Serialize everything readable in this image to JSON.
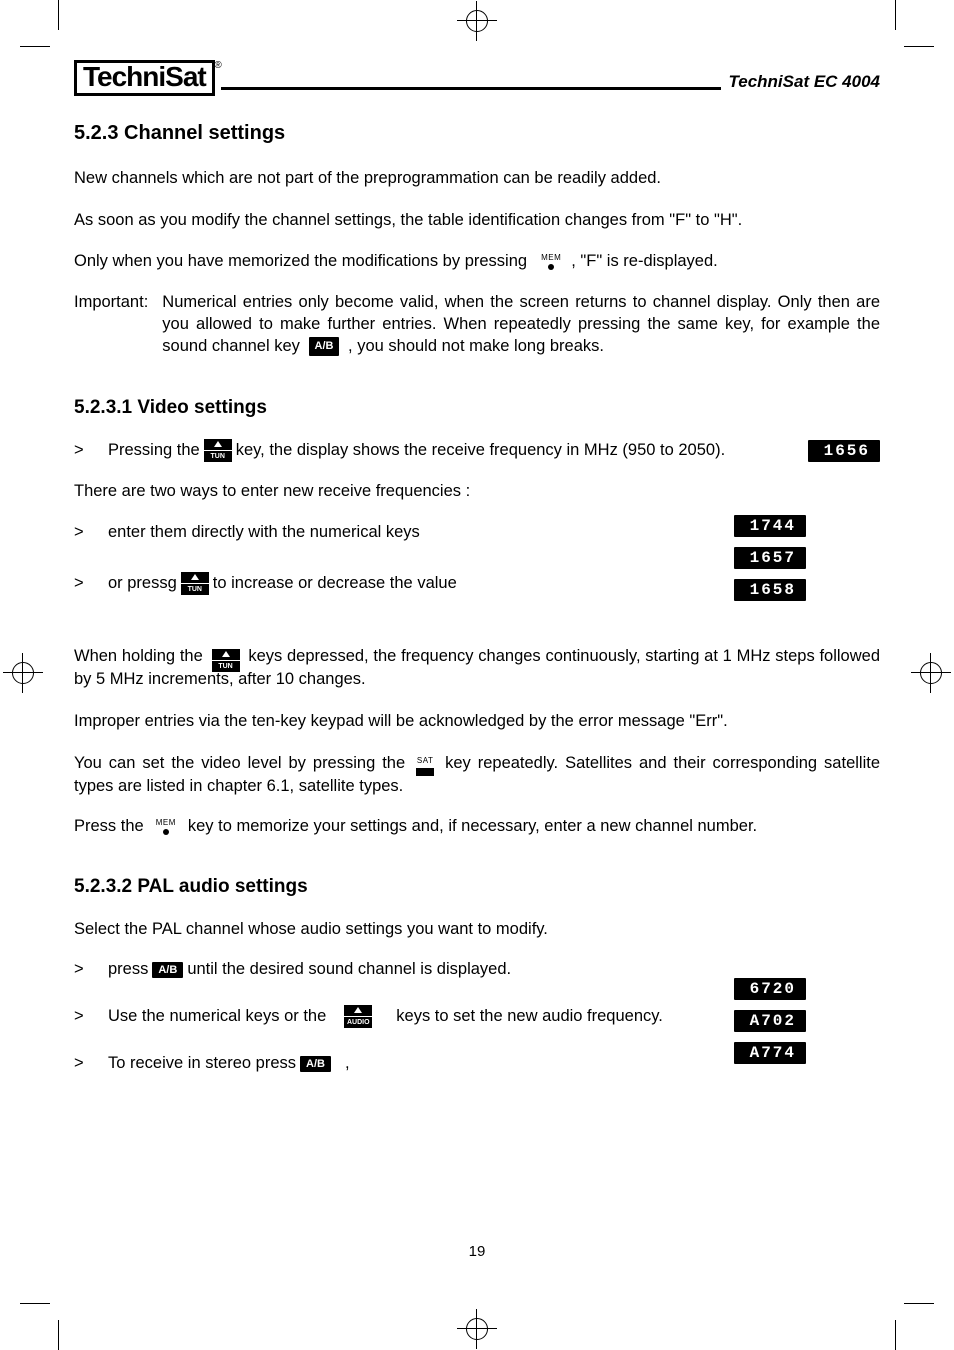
{
  "header": {
    "logo_text": "TechniSat",
    "logo_reg": "®",
    "model": "TechniSat EC 4004"
  },
  "section_523": {
    "number_title": "5.2.3 Channel settings",
    "p1": "New channels which are not part of the preprogrammation can be readily added.",
    "p2": "As soon as you modify the channel settings, the table identification changes from \"F\" to \"H\".",
    "p3_a": "Only when you have memorized the modifications by pressing",
    "p3_b": ", \"F\" is re-displayed.",
    "important_label": "Important:",
    "important_a": "Numerical entries only become valid, when the screen returns to channel display. Only then are you allowed to make further entries. When repeatedly pressing the same key, for example the sound channel key",
    "important_b": ", you should not make long breaks."
  },
  "section_5231": {
    "number_title": "5.2.3.1  Video settings",
    "b1_a": "Pressing the",
    "b1_b": "key, the display shows the receive frequency in MHz (950 to 2050).",
    "p_twoways": "There are two ways to enter new receive frequencies :",
    "b2": "enter them directly with the numerical keys",
    "b3_a": "or pressg",
    "b3_b": "to increase or decrease the value",
    "p_hold_a": "When holding the",
    "p_hold_b": "keys depressed, the frequency changes continuously, starting at 1 MHz steps followed by 5 MHz increments, after 10 changes.",
    "p_err": "Improper entries via the ten-key keypad will be acknowledged by the error message \"Err\".",
    "p_sat_a": "You can set the video level by pressing the",
    "p_sat_b": "key repeatedly. Satellites and their corresponding satellite types are listed in chapter 6.1, satellite types.",
    "p_mem_a": "Press the",
    "p_mem_b": "key to memorize your settings and, if necessary, enter a new channel number."
  },
  "section_5232": {
    "number_title": "5.2.3.2 PAL audio settings",
    "p1": "Select the PAL channel whose audio settings you want to modify.",
    "b1_a": "press",
    "b1_b": "until the desired sound channel is displayed.",
    "b2_a": "Use the numerical keys or the",
    "b2_b": "keys to set the new audio frequency.",
    "b3_a": "To receive in stereo press",
    "b3_b": ","
  },
  "keys": {
    "mem": "MEM",
    "sat": "SAT",
    "ab": "A/B",
    "tun": "TUN",
    "audio": "AUDIO"
  },
  "displays": {
    "d1": "1656",
    "d2": "1744",
    "d3": "1657",
    "d4": "1658",
    "d5": "6720",
    "d6": "A702",
    "d7": "A774"
  },
  "bullet_marker": ">",
  "page_number": "19"
}
